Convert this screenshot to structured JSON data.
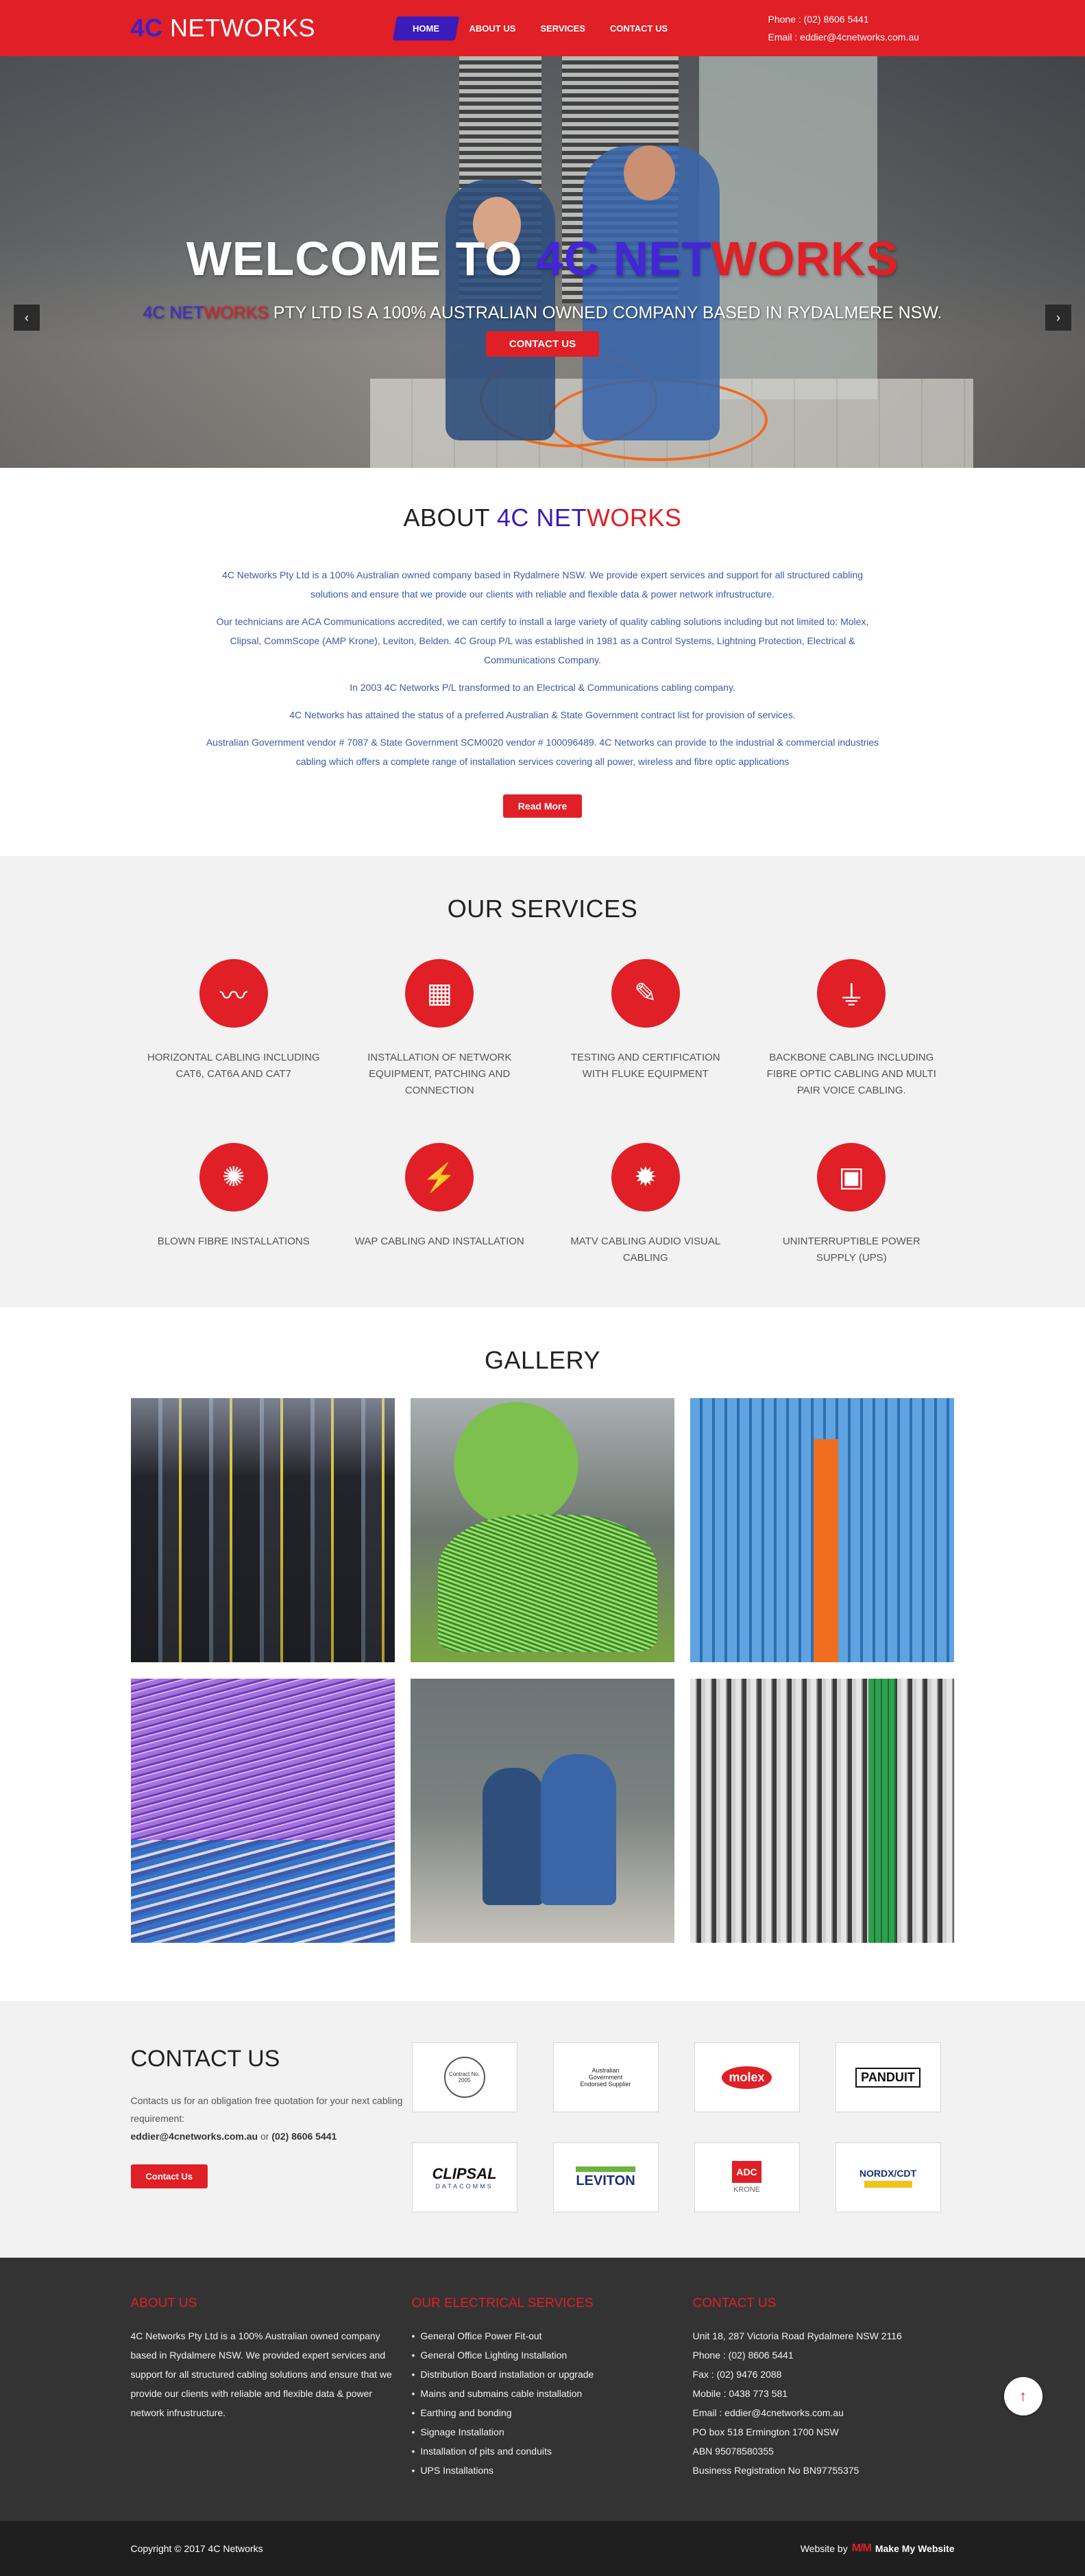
{
  "header": {
    "logo_prefix": "4C",
    "logo_suffix": " NETWORKS",
    "nav": [
      "HOME",
      "ABOUT US",
      "SERVICES",
      "CONTACT US"
    ],
    "phone": "Phone : (02) 8606 5441",
    "email": "Email : eddier@4cnetworks.com.au"
  },
  "hero": {
    "title_a": "WELCOME TO ",
    "title_b": "4C NET",
    "title_c": "WORKS",
    "sub_b": "4C NET",
    "sub_r": "WORKS",
    "sub_rest": " PTY LTD IS A 100% AUSTRALIAN OWNED COMPANY BASED IN RYDALMERE NSW.",
    "button": "CONTACT US",
    "prev": "‹",
    "next": "›"
  },
  "about": {
    "title_a": "ABOUT ",
    "title_b": "4C NET",
    "title_c": "WORKS",
    "paragraphs": [
      "4C Networks Pty Ltd is a 100% Australian owned company based in Rydalmere NSW. We provide expert services and support for all structured cabling solutions and ensure that we provide our clients with reliable and flexible data & power network infrustructure.",
      "Our technicians are ACA Communications accredited, we can certify to install a large variety of quality cabling solutions including but not limited to: Molex, Clipsal, CommScope (AMP Krone), Leviton, Belden. 4C Group P/L was established in 1981 as a Control Systems, Lightning Protection, Electrical & Communications Company.",
      "In 2003 4C Networks P/L transformed to an Electrical & Communications cabling company.",
      "4C Networks has attained the status of a preferred Australian & State Government contract list for provision of services.",
      "Australian Government vendor # 7087 & State Government SCM0020 vendor # 100096489. 4C Networks can provide to the industrial & commercial industries cabling which offers a complete range of installation services covering all power, wireless and fibre optic applications"
    ],
    "button": "Read More"
  },
  "services": {
    "title": "OUR SERVICES",
    "items": [
      {
        "label": "HORIZONTAL CABLING INCLUDING CAT6, CAT6A AND CAT7",
        "icon": "cable-icon",
        "glyph": "〰"
      },
      {
        "label": "INSTALLATION OF NETWORK EQUIPMENT, PATCHING AND CONNECTION",
        "icon": "network-port-icon",
        "glyph": "▦"
      },
      {
        "label": "TESTING AND CERTIFICATION WITH FLUKE EQUIPMENT",
        "icon": "certificate-icon",
        "glyph": "✎"
      },
      {
        "label": "BACKBONE CABLING INCLUDING FIBRE OPTIC CABLING AND MULTI PAIR VOICE CABLING.",
        "icon": "connector-icon",
        "glyph": "⏚"
      },
      {
        "label": "BLOWN FIBRE INSTALLATIONS",
        "icon": "fibre-icon",
        "glyph": "✺"
      },
      {
        "label": "WAP CABLING AND INSTALLATION",
        "icon": "plug-icon",
        "glyph": "⚡"
      },
      {
        "label": "MATV CABLING AUDIO VISUAL CABLING",
        "icon": "fibre-burst-icon",
        "glyph": "✹"
      },
      {
        "label": "UNINTERRUPTIBLE POWER SUPPLY (UPS)",
        "icon": "ups-icon",
        "glyph": "▣"
      }
    ]
  },
  "gallery": {
    "title": "GALLERY"
  },
  "contact": {
    "title": "CONTACT US",
    "text": "Contacts us for an obligation free quotation for your next cabling requirement:",
    "email": "eddier@4cnetworks.com.au",
    "or": " or ",
    "phone": "(02) 8606 5441",
    "button": "Contact Us",
    "logos": [
      {
        "name": "cert-seal-logo",
        "text": "Contract No. 2005"
      },
      {
        "name": "gov-supplier-logo",
        "text": "Australian Government Endorsed Supplier"
      },
      {
        "name": "molex-logo",
        "text": "molex"
      },
      {
        "name": "panduit-logo",
        "text": "PANDUIT"
      },
      {
        "name": "clipsal-logo",
        "text": "CLIPSAL"
      },
      {
        "name": "leviton-logo",
        "text": "LEVITON"
      },
      {
        "name": "adc-krone-logo",
        "text": "KRONE"
      },
      {
        "name": "nordx-cdt-logo",
        "text": "NORDX/CDT"
      }
    ]
  },
  "footer": {
    "about_title": "ABOUT US",
    "about_text": "4C Networks Pty Ltd is a 100% Australian owned company based in Rydalmere NSW. We provided expert services and support for all structured cabling solutions and ensure that we provide our clients with reliable and flexible data & power network infrustructure.",
    "services_title": "OUR ELECTRICAL SERVICES",
    "services": [
      "General Office Power Fit-out",
      "General Office Lighting Installation",
      "Distribution Board installation or upgrade",
      "Mains and submains cable installation",
      "Earthing and bonding",
      "Signage Installation",
      "Installation of pits and conduits",
      "UPS Installations"
    ],
    "contact_title": "CONTACT US",
    "contact_lines": [
      "Unit 18, 287 Victoria Road Rydalmere NSW 2116",
      "Phone : (02) 8606 5441",
      "Fax : (02) 9476 2088",
      "Mobile : 0438 773 581",
      "Email : eddier@4cnetworks.com.au",
      "PO box 518 Ermington 1700 NSW",
      "ABN 95078580355",
      "Business Registration No BN97755375"
    ]
  },
  "bottom": {
    "copyright": "Copyright © 2017 4C Networks",
    "website_by": "Website by",
    "mmw_mark": "M/M",
    "mmw_name": "Make My Website",
    "to_top": "↑"
  },
  "colors": {
    "brand_red": "#e01f26",
    "brand_blue": "#3b1bb9",
    "footer_dark": "#333333"
  }
}
